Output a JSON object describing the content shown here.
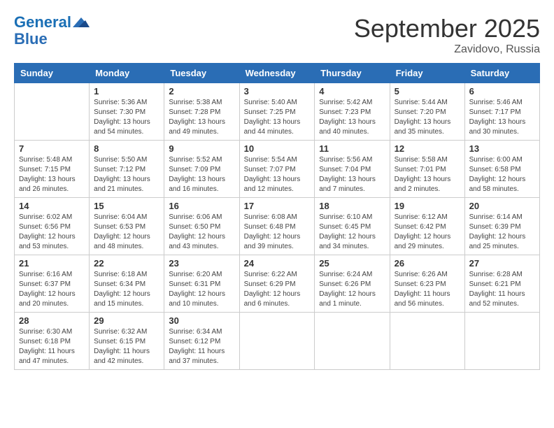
{
  "header": {
    "logo_line1": "General",
    "logo_line2": "Blue",
    "month": "September 2025",
    "location": "Zavidovo, Russia"
  },
  "weekdays": [
    "Sunday",
    "Monday",
    "Tuesday",
    "Wednesday",
    "Thursday",
    "Friday",
    "Saturday"
  ],
  "weeks": [
    [
      {
        "day": "",
        "info": ""
      },
      {
        "day": "1",
        "info": "Sunrise: 5:36 AM\nSunset: 7:30 PM\nDaylight: 13 hours\nand 54 minutes."
      },
      {
        "day": "2",
        "info": "Sunrise: 5:38 AM\nSunset: 7:28 PM\nDaylight: 13 hours\nand 49 minutes."
      },
      {
        "day": "3",
        "info": "Sunrise: 5:40 AM\nSunset: 7:25 PM\nDaylight: 13 hours\nand 44 minutes."
      },
      {
        "day": "4",
        "info": "Sunrise: 5:42 AM\nSunset: 7:23 PM\nDaylight: 13 hours\nand 40 minutes."
      },
      {
        "day": "5",
        "info": "Sunrise: 5:44 AM\nSunset: 7:20 PM\nDaylight: 13 hours\nand 35 minutes."
      },
      {
        "day": "6",
        "info": "Sunrise: 5:46 AM\nSunset: 7:17 PM\nDaylight: 13 hours\nand 30 minutes."
      }
    ],
    [
      {
        "day": "7",
        "info": "Sunrise: 5:48 AM\nSunset: 7:15 PM\nDaylight: 13 hours\nand 26 minutes."
      },
      {
        "day": "8",
        "info": "Sunrise: 5:50 AM\nSunset: 7:12 PM\nDaylight: 13 hours\nand 21 minutes."
      },
      {
        "day": "9",
        "info": "Sunrise: 5:52 AM\nSunset: 7:09 PM\nDaylight: 13 hours\nand 16 minutes."
      },
      {
        "day": "10",
        "info": "Sunrise: 5:54 AM\nSunset: 7:07 PM\nDaylight: 13 hours\nand 12 minutes."
      },
      {
        "day": "11",
        "info": "Sunrise: 5:56 AM\nSunset: 7:04 PM\nDaylight: 13 hours\nand 7 minutes."
      },
      {
        "day": "12",
        "info": "Sunrise: 5:58 AM\nSunset: 7:01 PM\nDaylight: 13 hours\nand 2 minutes."
      },
      {
        "day": "13",
        "info": "Sunrise: 6:00 AM\nSunset: 6:58 PM\nDaylight: 12 hours\nand 58 minutes."
      }
    ],
    [
      {
        "day": "14",
        "info": "Sunrise: 6:02 AM\nSunset: 6:56 PM\nDaylight: 12 hours\nand 53 minutes."
      },
      {
        "day": "15",
        "info": "Sunrise: 6:04 AM\nSunset: 6:53 PM\nDaylight: 12 hours\nand 48 minutes."
      },
      {
        "day": "16",
        "info": "Sunrise: 6:06 AM\nSunset: 6:50 PM\nDaylight: 12 hours\nand 43 minutes."
      },
      {
        "day": "17",
        "info": "Sunrise: 6:08 AM\nSunset: 6:48 PM\nDaylight: 12 hours\nand 39 minutes."
      },
      {
        "day": "18",
        "info": "Sunrise: 6:10 AM\nSunset: 6:45 PM\nDaylight: 12 hours\nand 34 minutes."
      },
      {
        "day": "19",
        "info": "Sunrise: 6:12 AM\nSunset: 6:42 PM\nDaylight: 12 hours\nand 29 minutes."
      },
      {
        "day": "20",
        "info": "Sunrise: 6:14 AM\nSunset: 6:39 PM\nDaylight: 12 hours\nand 25 minutes."
      }
    ],
    [
      {
        "day": "21",
        "info": "Sunrise: 6:16 AM\nSunset: 6:37 PM\nDaylight: 12 hours\nand 20 minutes."
      },
      {
        "day": "22",
        "info": "Sunrise: 6:18 AM\nSunset: 6:34 PM\nDaylight: 12 hours\nand 15 minutes."
      },
      {
        "day": "23",
        "info": "Sunrise: 6:20 AM\nSunset: 6:31 PM\nDaylight: 12 hours\nand 10 minutes."
      },
      {
        "day": "24",
        "info": "Sunrise: 6:22 AM\nSunset: 6:29 PM\nDaylight: 12 hours\nand 6 minutes."
      },
      {
        "day": "25",
        "info": "Sunrise: 6:24 AM\nSunset: 6:26 PM\nDaylight: 12 hours\nand 1 minute."
      },
      {
        "day": "26",
        "info": "Sunrise: 6:26 AM\nSunset: 6:23 PM\nDaylight: 11 hours\nand 56 minutes."
      },
      {
        "day": "27",
        "info": "Sunrise: 6:28 AM\nSunset: 6:21 PM\nDaylight: 11 hours\nand 52 minutes."
      }
    ],
    [
      {
        "day": "28",
        "info": "Sunrise: 6:30 AM\nSunset: 6:18 PM\nDaylight: 11 hours\nand 47 minutes."
      },
      {
        "day": "29",
        "info": "Sunrise: 6:32 AM\nSunset: 6:15 PM\nDaylight: 11 hours\nand 42 minutes."
      },
      {
        "day": "30",
        "info": "Sunrise: 6:34 AM\nSunset: 6:12 PM\nDaylight: 11 hours\nand 37 minutes."
      },
      {
        "day": "",
        "info": ""
      },
      {
        "day": "",
        "info": ""
      },
      {
        "day": "",
        "info": ""
      },
      {
        "day": "",
        "info": ""
      }
    ]
  ]
}
